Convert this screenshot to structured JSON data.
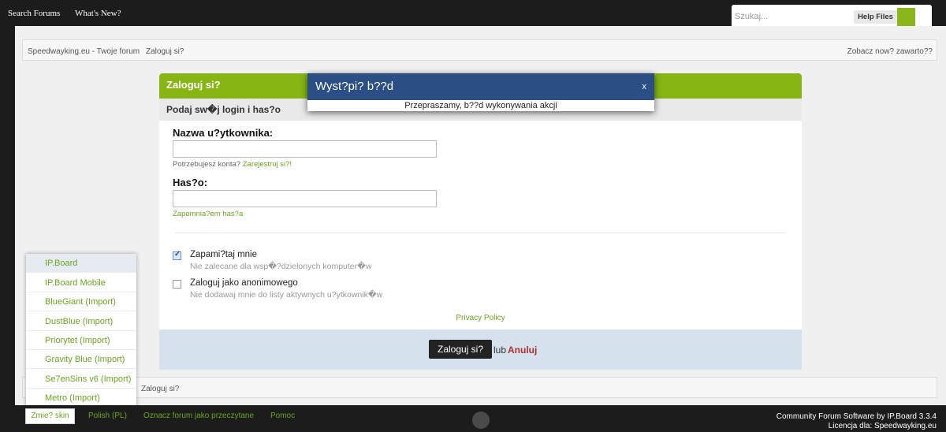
{
  "topbar": {
    "nav": [
      "Search Forums",
      "What's New?"
    ],
    "search_placeholder": "Szukaj...",
    "help_button": "Help Files"
  },
  "breadcrumb": {
    "items": [
      "Speedwayking.eu - Twoje forum",
      "Zaloguj si?"
    ],
    "right_link": "Zobacz now? zawarto??"
  },
  "login": {
    "title": "Zaloguj si?",
    "subtitle": "Podaj sw�j login i has?o",
    "username_label": "Nazwa u?ytkownika:",
    "username_value": "",
    "register_prompt": "Potrzebujesz konta?",
    "register_link": "Zarejestruj si?!",
    "password_label": "Has?o:",
    "password_value": "",
    "forgot_link": "Zapomnia?em has?a",
    "remember_label": "Zapami?taj mnie",
    "remember_hint": "Nie zalecane dla wsp�?dzielonych komputer�w",
    "remember_checked": true,
    "anon_label": "Zaloguj jako anonimowego",
    "anon_hint": "Nie dodawaj mnie do listy aktywnych u?ytkownik�w",
    "anon_checked": false,
    "privacy_link": "Privacy Policy",
    "submit_label": "Zaloguj si?",
    "or_text": "lub",
    "cancel_link": "Anuluj"
  },
  "bottom_breadcrumb": "Zaloguj si?",
  "skin_menu": [
    "IP.Board",
    "IP.Board Mobile",
    "BlueGiant (Import)",
    "DustBlue (Import)",
    "Priorytet (Import)",
    "Gravity Blue (Import)",
    "Se7enSins v6 (Import)",
    "Metro (Import)"
  ],
  "footer": {
    "skin_button": "Zmie? skin",
    "links": [
      "Polish (PL)",
      "Oznacz forum jako przeczytane",
      "Pomoc"
    ],
    "credit": "Community Forum Software by IP.Board 3.3.4",
    "license": "Licencja dla: Speedwayking.eu"
  },
  "dialog": {
    "title": "Wyst?pi? b??d",
    "close": "x",
    "message": "Przepraszamy, b??d wykonywania akcji"
  },
  "colors": {
    "accent_green": "#86b514",
    "dialog_blue": "#2b4f85",
    "link_green": "#6aa51e",
    "cancel_red": "#b03030"
  }
}
